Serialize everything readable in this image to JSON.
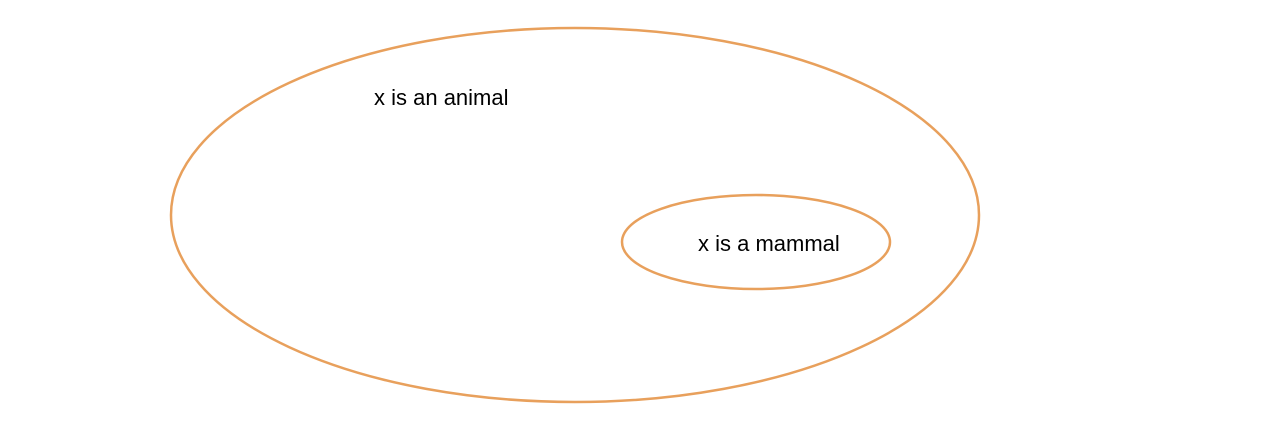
{
  "diagram": {
    "outer_set": {
      "label": "x is an animal",
      "stroke_color": "#E8A05C"
    },
    "inner_set": {
      "label": "x is a mammal",
      "stroke_color": "#E8A05C"
    },
    "text_color": "#000000",
    "background_color": "#FFFFFF"
  }
}
